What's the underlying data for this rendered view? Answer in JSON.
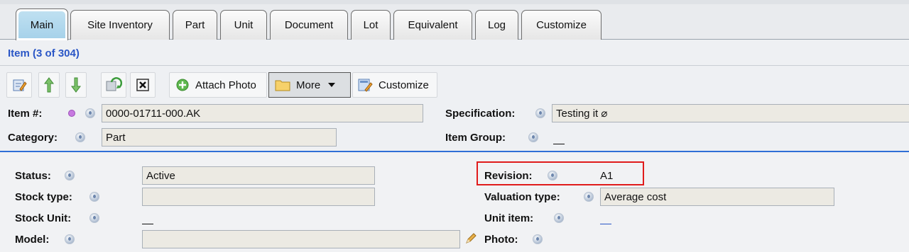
{
  "tabs": [
    "Main",
    "Site Inventory",
    "Part",
    "Unit",
    "Document",
    "Lot",
    "Equivalent",
    "Log",
    "Customize"
  ],
  "item_header": "Item (3 of 304)",
  "toolbar": {
    "attach_photo": "Attach Photo",
    "more": "More",
    "customize": "Customize"
  },
  "form": {
    "item_no_label": "Item #:",
    "item_no_value": "0000-01711-000.AK",
    "specification_label": "Specification:",
    "specification_value": "Testing it ⌀",
    "category_label": "Category:",
    "category_value": "Part",
    "item_group_label": "Item Group:",
    "status_label": "Status:",
    "status_value": "Active",
    "stock_type_label": "Stock type:",
    "stock_type_value": "",
    "stock_unit_label": "Stock Unit:",
    "model_label": "Model:",
    "model_value": "",
    "revision_label": "Revision:",
    "revision_value": "A1",
    "valuation_type_label": "Valuation type:",
    "valuation_type_value": "Average cost",
    "unit_item_label": "Unit item:",
    "photo_label": "Photo:"
  },
  "colors": {
    "accent_blue": "#2a56c6",
    "active_tab": "#a6d2ea",
    "highlight_red": "#e01b1b"
  }
}
